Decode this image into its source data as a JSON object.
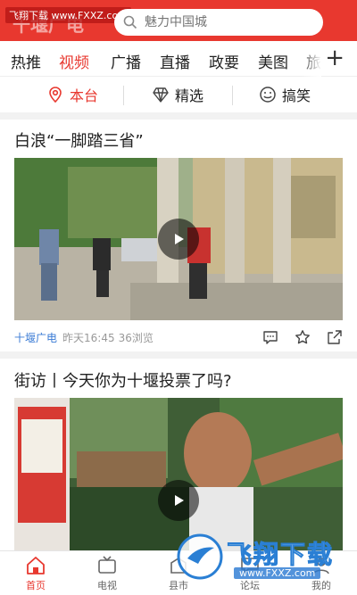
{
  "header": {
    "watermark": "飞翔下载 www.FXXZ.com",
    "logo": "十堰广电",
    "search_placeholder": "魅力中国城"
  },
  "channels": [
    "热推",
    "视频",
    "广播",
    "直播",
    "政要",
    "美图",
    "旅"
  ],
  "channel_active": "视频",
  "plus_label": "+",
  "subtabs": [
    {
      "label": "本台",
      "icon": "location-pin-icon"
    },
    {
      "label": "精选",
      "icon": "diamond-icon"
    },
    {
      "label": "搞笑",
      "icon": "smile-icon"
    }
  ],
  "feed": [
    {
      "title": "白浪“一脚踏三省”",
      "source": "十堰广电",
      "time": "昨天16:45",
      "views": "36浏览"
    },
    {
      "title": "街访丨今天你为十堰投票了吗?"
    }
  ],
  "bottom_nav": [
    {
      "label": "首页",
      "icon": "home-icon"
    },
    {
      "label": "电视",
      "icon": "tv-icon"
    },
    {
      "label": "县市",
      "icon": "county-icon"
    },
    {
      "label": "论坛",
      "icon": "forum-icon"
    },
    {
      "label": "我的",
      "icon": "profile-icon"
    }
  ],
  "watermark_bottom": {
    "text": "飞翔下载",
    "url": "www.FXXZ.com"
  },
  "colors": {
    "accent": "#e8382f",
    "link": "#3a7bd5"
  }
}
